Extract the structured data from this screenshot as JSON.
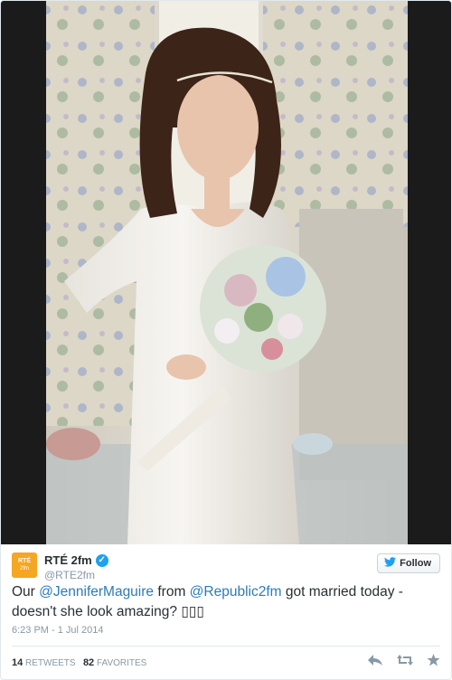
{
  "tweet": {
    "author_name": "RTÉ 2fm",
    "author_handle": "@RTE2fm",
    "avatar_line1": "RTÉ",
    "avatar_line2": "2fm",
    "verified_glyph": "✓",
    "follow_label": "Follow",
    "text_part1": "Our ",
    "mention1": "@JenniferMaguire",
    "text_part2": " from ",
    "mention2": "@Republic2fm",
    "text_part3": " got married today - doesn't she look amazing? ",
    "emoji_placeholder": "▯▯▯",
    "timestamp": "6:23 PM - 1 Jul 2014",
    "retweets_count": "14",
    "retweets_label": "RETWEETS",
    "favorites_count": "82",
    "favorites_label": "FAVORITES"
  },
  "icons": {
    "reply": "reply-icon",
    "retweet": "retweet-icon",
    "favorite": "favorite-icon",
    "follow_bird": "twitter-bird-icon",
    "verified": "verified-badge-icon"
  },
  "colors": {
    "link": "#2b7bb9",
    "verified": "#1da1f2",
    "avatar": "#f5a623",
    "text": "#292f33",
    "muted": "#8899a6"
  }
}
